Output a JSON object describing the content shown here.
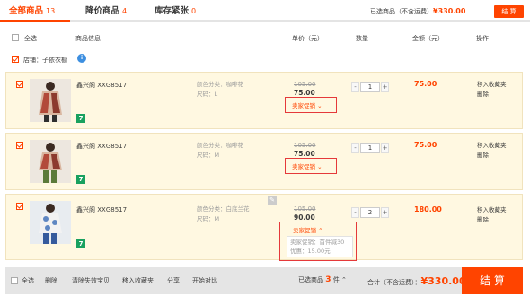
{
  "tabs": [
    {
      "label": "全部商品",
      "count": "13"
    },
    {
      "label": "降价商品",
      "count": "4"
    },
    {
      "label": "库存紧张",
      "count": "0"
    }
  ],
  "summary": {
    "prefix": "已选商品（不含运费）",
    "amount": "¥330.00",
    "settle": "结 算"
  },
  "header": {
    "select_all": "全选",
    "info": "商品信息",
    "unit_price": "单价（元）",
    "quantity": "数量",
    "amount": "金额（元）",
    "action": "操作"
  },
  "shop": {
    "label": "店铺：",
    "name": "子依衣橱"
  },
  "items": [
    {
      "title": "鑫兴阁 XXG8517",
      "color": "颜色分类：咖啡花",
      "size": "尺码：L",
      "orig_price": "105.00",
      "price": "75.00",
      "promo": "卖家促销",
      "qty": "1",
      "amount": "75.00",
      "fav": "移入收藏夹",
      "del": "删除",
      "badge": "7"
    },
    {
      "title": "鑫兴阁 XXG8517",
      "color": "颜色分类：咖啡花",
      "size": "尺码：M",
      "orig_price": "105.00",
      "price": "75.00",
      "promo": "卖家促销",
      "qty": "1",
      "amount": "75.00",
      "fav": "移入收藏夹",
      "del": "删除",
      "badge": "7"
    },
    {
      "title": "鑫兴阁 XXG8517",
      "color": "颜色分类：白底兰花",
      "size": "尺码：M",
      "orig_price": "105.00",
      "price": "90.00",
      "promo": "卖家促销",
      "tip_line1": "卖家促销：首件减30",
      "tip_line2": "优惠：15.00元",
      "qty": "2",
      "amount": "180.00",
      "fav": "移入收藏夹",
      "del": "删除",
      "badge": "7"
    }
  ],
  "footer": {
    "select_all": "全选",
    "delete": "删除",
    "clear_invalid": "清除失效宝贝",
    "move_fav": "移入收藏夹",
    "share": "分享",
    "compare": "开始对比",
    "selected_prefix": "已选商品",
    "selected_count": "3",
    "selected_suffix": "件",
    "total_prefix": "合计（不含运费）：",
    "total": "¥330.00",
    "settle": "结 算"
  },
  "colors": {
    "accent": "#ff4400",
    "row_bg": "#fff8e1",
    "highlight_box": "#e5393a"
  }
}
